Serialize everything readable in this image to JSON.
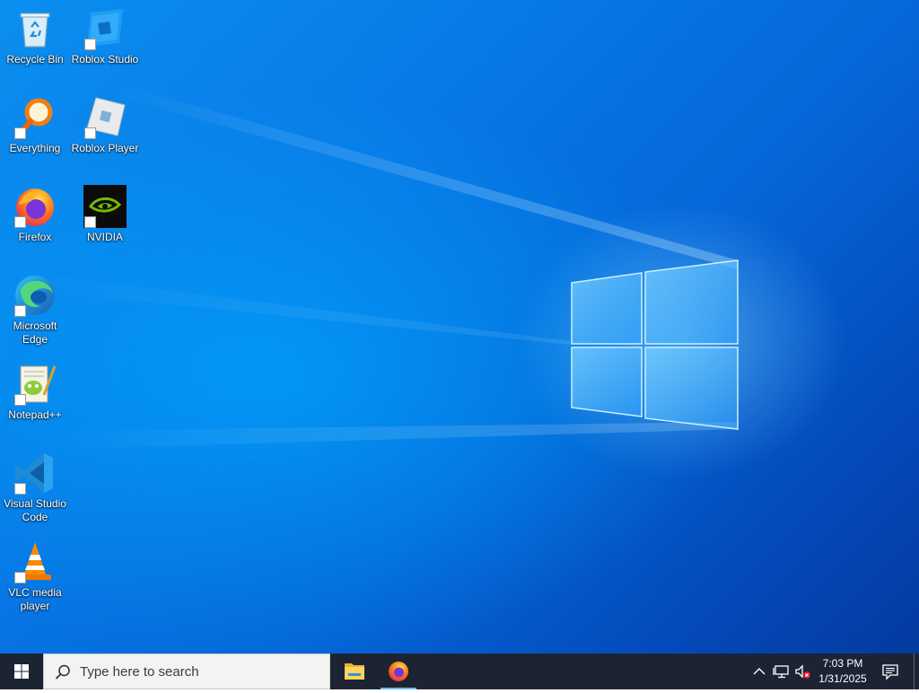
{
  "desktop": {
    "icons": [
      {
        "id": "recycle-bin",
        "label": "Recycle Bin",
        "shortcut": false
      },
      {
        "id": "roblox-studio",
        "label": "Roblox Studio",
        "shortcut": true
      },
      {
        "id": "everything",
        "label": "Everything",
        "shortcut": true
      },
      {
        "id": "roblox-player",
        "label": "Roblox Player",
        "shortcut": true
      },
      {
        "id": "firefox",
        "label": "Firefox",
        "shortcut": true
      },
      {
        "id": "nvidia",
        "label": "NVIDIA",
        "shortcut": true
      },
      {
        "id": "microsoft-edge",
        "label": "Microsoft\nEdge",
        "shortcut": true
      },
      {
        "id": "notepad-plus-plus",
        "label": "Notepad++",
        "shortcut": true
      },
      {
        "id": "visual-studio-code",
        "label": "Visual Studio\nCode",
        "shortcut": true
      },
      {
        "id": "vlc-media-player",
        "label": "VLC media\nplayer",
        "shortcut": true
      }
    ]
  },
  "taskbar": {
    "search_placeholder": "Type here to search",
    "pinned_apps": [
      {
        "id": "file-explorer",
        "icon": "folder-icon"
      },
      {
        "id": "firefox",
        "icon": "firefox-icon",
        "active": true
      }
    ],
    "tray": {
      "icons": [
        "chevron-up-icon",
        "network-icon",
        "volume-muted-icon"
      ],
      "time": "7:03 PM",
      "date": "1/31/2025",
      "notification_icon": "action-center-icon"
    }
  },
  "colors": {
    "taskbar": "#1c2433",
    "wallpaper_accent": "#0878e6"
  }
}
